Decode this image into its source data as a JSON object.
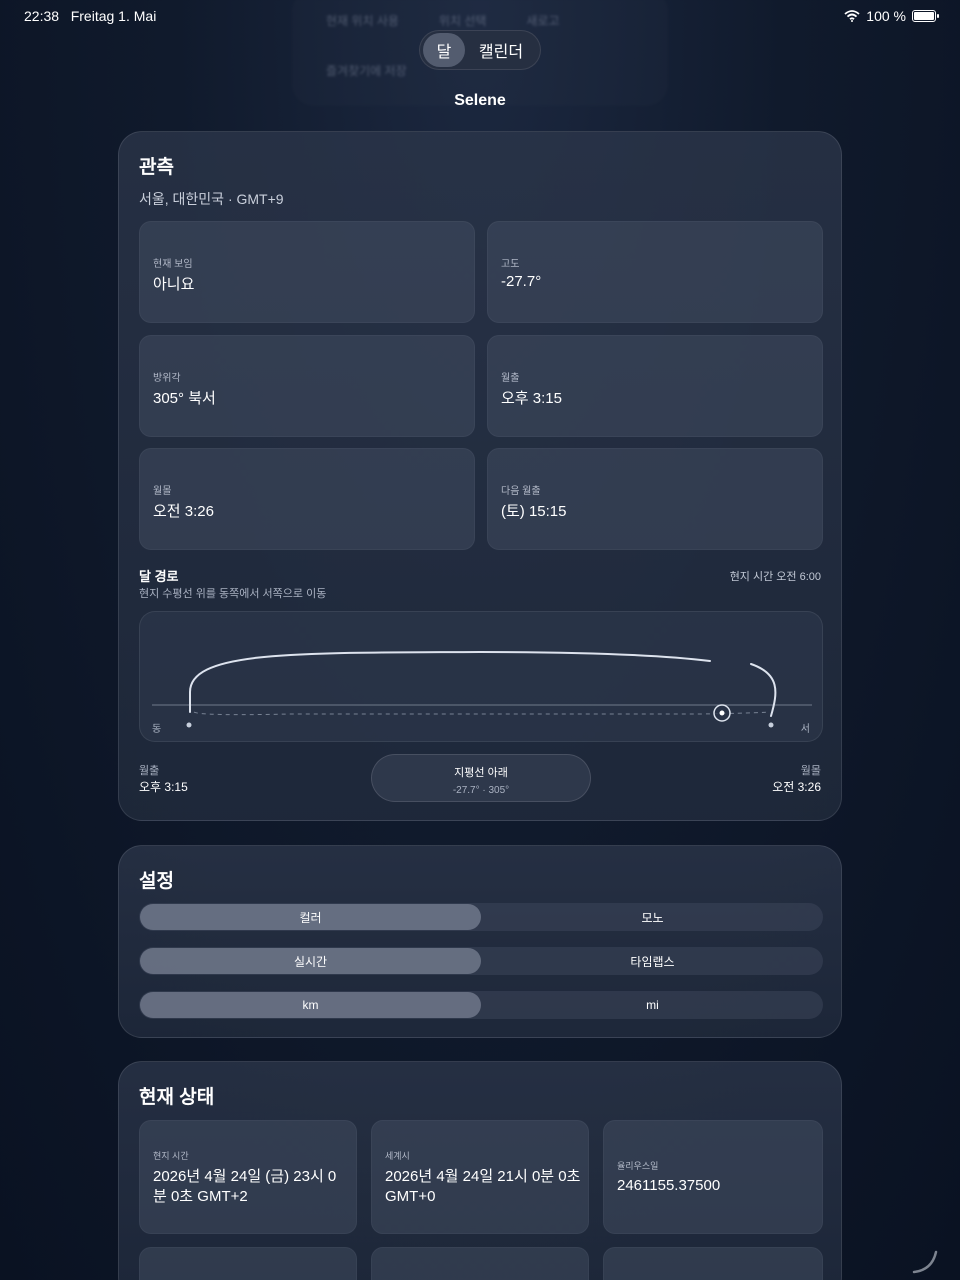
{
  "status": {
    "time": "22:38",
    "date": "Freitag 1. Mai",
    "wifi": "wifi-icon",
    "battery": "100 %",
    "battery_level": 1.0
  },
  "ghost_menu": {
    "item1": "현재 위치 사용",
    "item2": "위치 선택",
    "item3": "새로고",
    "item4": "즐겨찾기에 저장"
  },
  "top_tabs": {
    "moon": "달",
    "calendar": "캘린더",
    "selected": "달"
  },
  "app_title": "Selene",
  "observation": {
    "title": "관측",
    "location": "서울, 대한민국 · GMT+9",
    "tiles": [
      {
        "label": "현재 보임",
        "value": "아니요"
      },
      {
        "label": "고도",
        "value": "-27.7°"
      },
      {
        "label": "방위각",
        "value": "305° 북서"
      },
      {
        "label": "월출",
        "value": "오후 3:15"
      },
      {
        "label": "월몰",
        "value": "오전 3:26"
      },
      {
        "label": "다음 월출",
        "value": "(토) 15:15"
      }
    ],
    "path": {
      "title": "달 경로",
      "subtitle": "현지 수평선 위를 동쪽에서 서쪽으로 이동",
      "local_time": "현지 시간 오전 6:00",
      "east": "동",
      "west": "서",
      "rise_label": "월출",
      "rise_value": "오후 3:15",
      "set_label": "월몰",
      "set_value": "오전 3:26",
      "status_title": "지평선 아래",
      "status_detail": "-27.7° · 305°"
    }
  },
  "settings": {
    "title": "설정",
    "rows": [
      {
        "a": "컬러",
        "b": "모노",
        "selected": "컬러"
      },
      {
        "a": "실시간",
        "b": "타임랩스",
        "selected": "실시간"
      },
      {
        "a": "km",
        "b": "mi",
        "selected": "km"
      }
    ]
  },
  "current_state": {
    "title": "현재 상태",
    "tiles": [
      {
        "label": "현지 시간",
        "value": "2026년 4월 24일 (금) 23시 0분 0초 GMT+2"
      },
      {
        "label": "세계시",
        "value": "2026년 4월 24일 21시 0분 0초 GMT+0"
      },
      {
        "label": "율리우스일",
        "value": "2461155.37500"
      }
    ]
  }
}
